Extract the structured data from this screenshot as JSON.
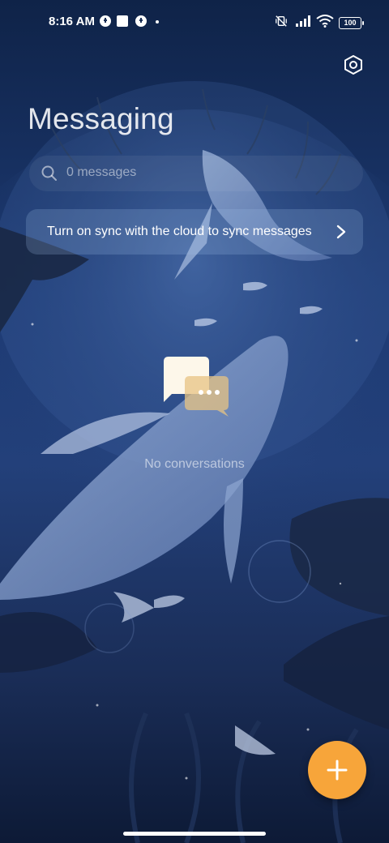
{
  "status_bar": {
    "time": "8:16 AM",
    "battery": "100",
    "icons": [
      "notification-app-icon",
      "notification-square-icon",
      "notification-app-icon-2",
      "vibrate-off-icon",
      "signal-icon",
      "wifi-icon",
      "battery-icon"
    ]
  },
  "header": {
    "title": "Messaging",
    "settings_icon": "settings-hexagon-icon"
  },
  "search": {
    "placeholder": "0 messages",
    "icon": "search-icon"
  },
  "sync_banner": {
    "text": "Turn on sync with the cloud to sync messages",
    "icon": "chevron-right-icon"
  },
  "empty_state": {
    "icon": "chat-bubbles-icon",
    "text": "No conversations"
  },
  "fab": {
    "icon": "plus-icon",
    "color": "#f7a53a"
  },
  "colors": {
    "accent": "#f7a53a",
    "background": "#1d3a73"
  }
}
